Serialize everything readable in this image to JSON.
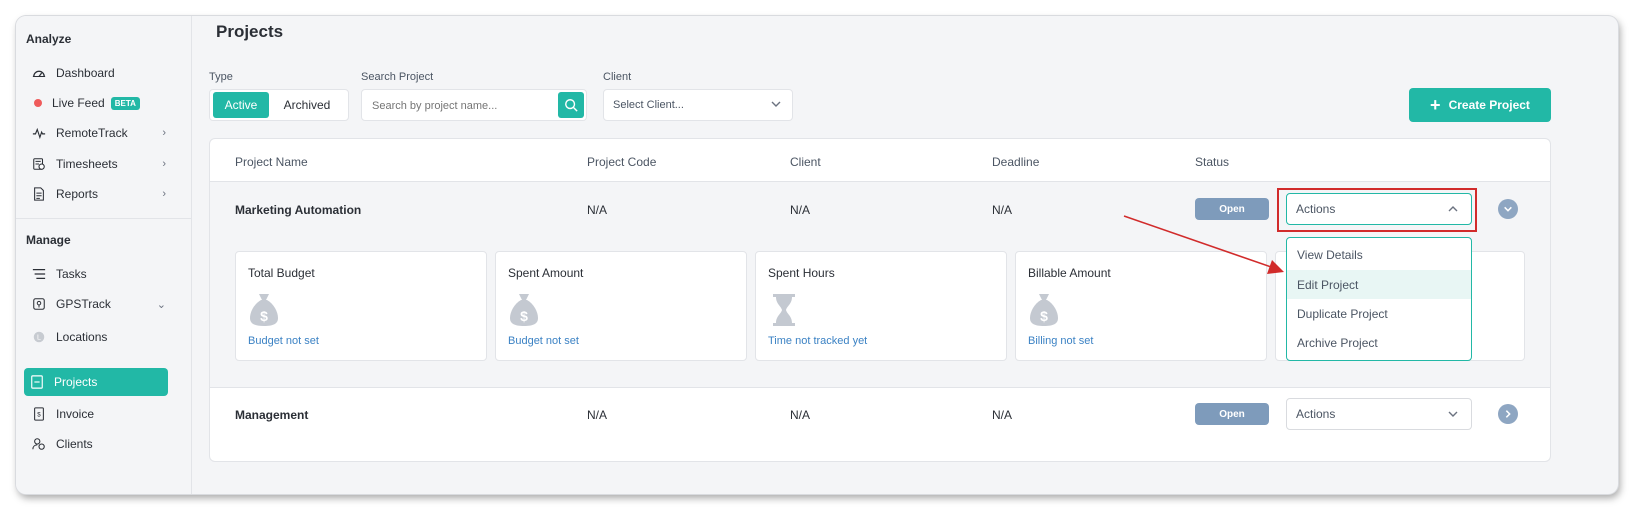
{
  "sidebar": {
    "analyze_title": "Analyze",
    "manage_title": "Manage",
    "items": [
      {
        "label": "Dashboard"
      },
      {
        "label": "Live Feed",
        "badge": "BETA"
      },
      {
        "label": "RemoteTrack"
      },
      {
        "label": "Timesheets"
      },
      {
        "label": "Reports"
      },
      {
        "label": "Tasks"
      },
      {
        "label": "GPSTrack"
      },
      {
        "label": "Locations"
      },
      {
        "label": "Projects"
      },
      {
        "label": "Invoice"
      },
      {
        "label": "Clients"
      }
    ]
  },
  "page": {
    "title": "Projects",
    "type_label": "Type",
    "type_active": "Active",
    "type_archived": "Archived",
    "search_label": "Search Project",
    "search_placeholder": "Search by project name...",
    "client_label": "Client",
    "client_select": "Select Client...",
    "create_button": "Create Project"
  },
  "table": {
    "headers": [
      "Project Name",
      "Project Code",
      "Client",
      "Deadline",
      "Status"
    ],
    "rows": [
      {
        "name": "Marketing Automation",
        "code": "N/A",
        "client": "N/A",
        "deadline": "N/A",
        "status": "Open",
        "actions": "Actions"
      },
      {
        "name": "Management",
        "code": "N/A",
        "client": "N/A",
        "deadline": "N/A",
        "status": "Open",
        "actions": "Actions"
      }
    ],
    "stats": [
      {
        "title": "Total Budget",
        "value": "Budget not set"
      },
      {
        "title": "Spent Amount",
        "value": "Budget not set"
      },
      {
        "title": "Spent Hours",
        "value": "Time not tracked yet"
      },
      {
        "title": "Billable Amount",
        "value": "Billing not set"
      }
    ],
    "actions_menu": [
      "View Details",
      "Edit Project",
      "Duplicate Project",
      "Archive Project"
    ]
  },
  "colors": {
    "accent": "#22b8a6",
    "status": "#7e9bbb",
    "annotation": "#d12b2b",
    "link": "#3b82c4"
  }
}
